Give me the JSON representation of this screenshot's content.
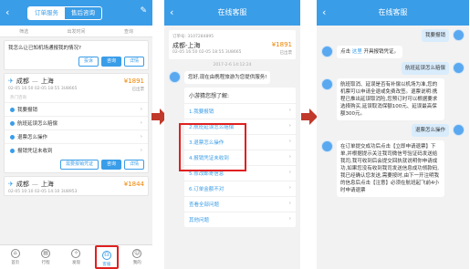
{
  "panel1": {
    "tabs": [
      "订单服务",
      "售后咨询"
    ],
    "back_icon": "‹",
    "edit_icon": "✎",
    "filter": [
      "筛选",
      "出发时间",
      "查询"
    ],
    "question": "我怎么让已知机场通报我的情况?",
    "buttons": [
      "投诉",
      "咨询",
      "详情"
    ],
    "order1": {
      "from": "成都",
      "to": "上海",
      "price": "¥1891",
      "date": "02-05 16:50",
      "time_to": "02-05 18:55",
      "flight": "3U8665",
      "status": "已出票"
    },
    "section": "热门咨询",
    "items": [
      "我要报销",
      "航班延误怎么赔偿",
      "退票怎么操作",
      "报销凭证未收到"
    ],
    "order_buttons": [
      "需要报销凭证",
      "咨询",
      "详情"
    ],
    "order2": {
      "from": "成都",
      "to": "上海",
      "price": "¥1844",
      "date": "02-05 10:10",
      "time_to": "02-05 14:10",
      "flight": "3U8953"
    },
    "nav": [
      "首页",
      "行程",
      "发现",
      "客服",
      "我的"
    ]
  },
  "panel2": {
    "title": "在线客服",
    "order": {
      "number_label": "订单号:",
      "number": "3107284895",
      "route": "成都-上海",
      "price": "¥1891",
      "date": "02-05 16:50",
      "time_to": "02-05 18:55",
      "flight": "3U8665",
      "status": "已出票"
    },
    "stamp": "2017-2-6 14:12:24",
    "greet": "您好,现在由携程旅游为您提供服务!",
    "menu_head": "小游猜您想了解:",
    "menu": [
      "1.我要报销",
      "2.航班延误怎么赔偿",
      "3.退票怎么操作",
      "4.报销凭证未收到",
      "5.修改邮寄信息",
      "6.订单金额不对",
      "查看全部问题",
      "其他问题"
    ]
  },
  "panel3": {
    "title": "在线客服",
    "u1": "我要报销",
    "a1_prefix": "点击",
    "a1_link": "这里",
    "a1_suffix": "开具报销凭证。",
    "u2": "航班延误怎么赔偿",
    "a2": "航班取消、延误是否有补偿以机场为准,您的机票可以申请全退或免费改签。退票说明:携程已推出延误取消险,您预订时可以根据要求选择购买,延误取消保额100元、延误最高保额300元。",
    "u3": "退票怎么操作",
    "a3": "在订单提交成功后点击【立即申请退票】下单,并根据提示关注我司微信号验证码发送给我司,我可收到后会提交回执就说明你申请成功,如果您没有收到我司发送信息成功领款码,我已经确认您发送,需要按时,由下一开注明我的信息后点击【注意】必须在航班起飞前4小时申请退票"
  }
}
